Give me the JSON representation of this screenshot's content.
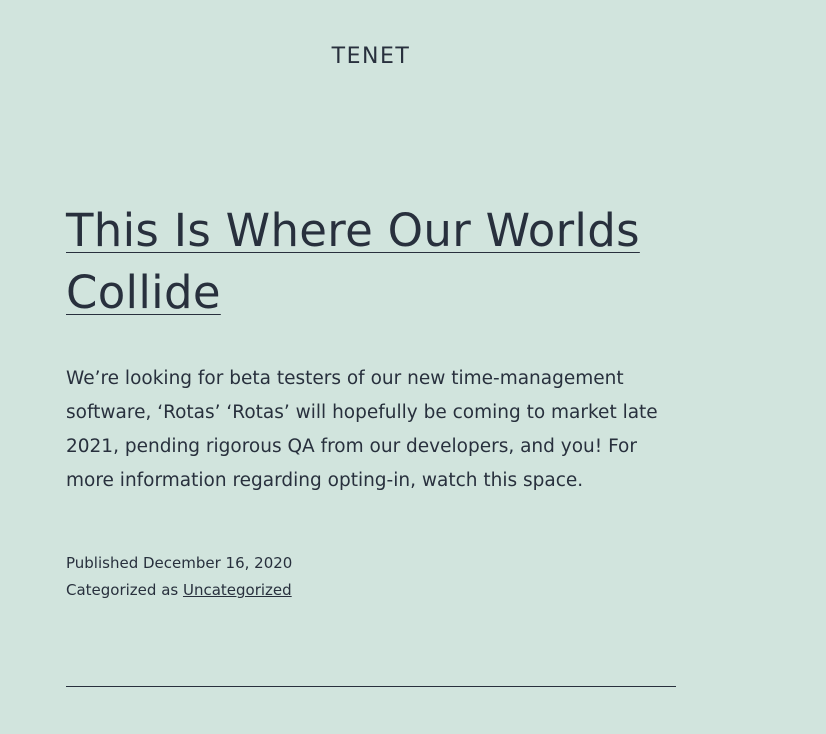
{
  "site": {
    "title": "TENET"
  },
  "post": {
    "title": "This Is Where Our Worlds Collide",
    "content": "We’re looking for beta testers of our new time-management software, ‘Rotas’ ‘Rotas’ will hopefully be coming to market late 2021, pending rigorous QA from our developers, and you! For more information regarding opting-in, watch this space.",
    "published_prefix": "Published ",
    "published_date": "December 16, 2020",
    "category_prefix": "Categorized as ",
    "category": "Uncategorized"
  },
  "colors": {
    "background": "#d1e4dd",
    "text": "#28303d"
  }
}
